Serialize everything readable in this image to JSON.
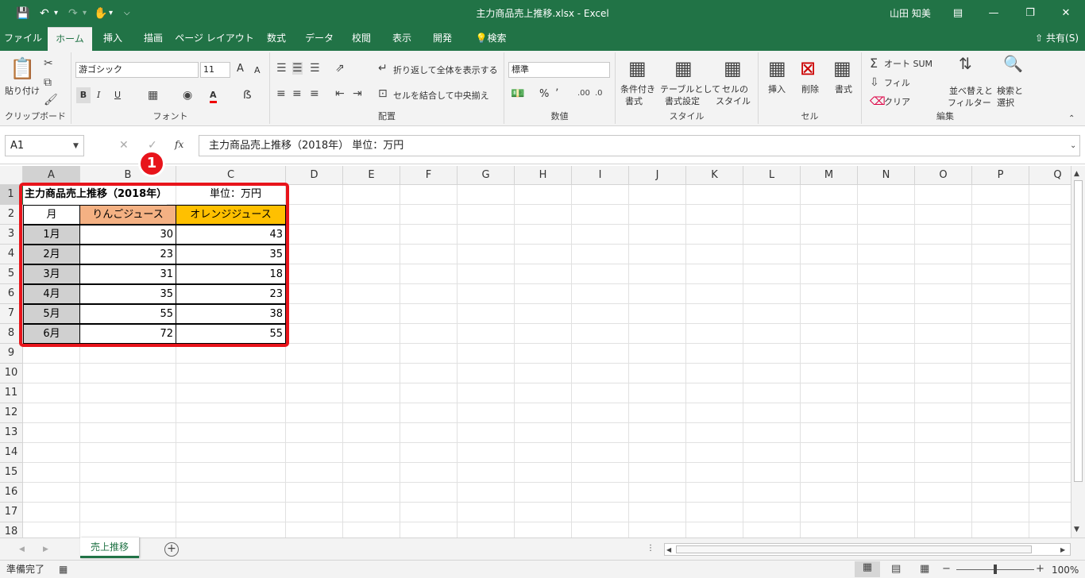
{
  "titlebar": {
    "title": "主力商品売上推移.xlsx  -  Excel",
    "user": "山田 知美",
    "save_icon": "save-icon",
    "undo_icon": "undo-icon",
    "redo_icon": "redo-icon",
    "touch_icon": "touch-mode-icon",
    "customize_icon": "customize-qat-icon"
  },
  "tabs": [
    "ファイル",
    "ホーム",
    "挿入",
    "描画",
    "ページ レイアウト",
    "数式",
    "データ",
    "校閲",
    "表示",
    "開発",
    "検索"
  ],
  "active_tab": "ホーム",
  "share_label": "共有(S)",
  "ribbon": {
    "clipboard": {
      "paste": "貼り付け",
      "label": "クリップボード"
    },
    "font": {
      "name": "游ゴシック",
      "size": "11",
      "bold": "B",
      "italic": "I",
      "underline": "U",
      "grow": "A",
      "shrink": "A",
      "font_color": "A",
      "label": "フォント"
    },
    "alignment": {
      "wrap": "折り返して全体を表示する",
      "merge": "セルを結合して中央揃え",
      "label": "配置"
    },
    "number": {
      "format": "標準",
      "percent": "%",
      "label": "数値"
    },
    "styles": {
      "conditional": "条件付き",
      "conditional2": "書式",
      "table": "テーブルとして",
      "table2": "書式設定",
      "cell": "セルの",
      "cell2": "スタイル",
      "label": "スタイル"
    },
    "cells": {
      "insert": "挿入",
      "delete": "削除",
      "format": "書式",
      "label": "セル"
    },
    "editing": {
      "autosum": "オート SUM",
      "fill": "フィル",
      "clear": "クリア",
      "sort": "並べ替えと",
      "sort2": "フィルター",
      "find": "検索と",
      "find2": "選択",
      "label": "編集"
    }
  },
  "formula_bar": {
    "namebox": "A1",
    "fx": "fx",
    "content": "主力商品売上推移（2018年）      単位：万円"
  },
  "columns": [
    "A",
    "B",
    "C",
    "D",
    "E",
    "F",
    "G",
    "H",
    "I",
    "J",
    "K",
    "L",
    "M",
    "N",
    "O",
    "P",
    "Q"
  ],
  "rows": [
    "1",
    "2",
    "3",
    "4",
    "5",
    "6",
    "7",
    "8",
    "9",
    "10",
    "11",
    "12",
    "13",
    "14",
    "15",
    "16",
    "17",
    "18"
  ],
  "sheet": {
    "title": "主力商品売上推移（2018年）",
    "unit": "単位：万円",
    "header": {
      "month": "月",
      "apple": "りんごジュース",
      "orange": "オレンジジュース"
    },
    "data": [
      {
        "month": "1月",
        "apple": "30",
        "orange": "43"
      },
      {
        "month": "2月",
        "apple": "23",
        "orange": "35"
      },
      {
        "month": "3月",
        "apple": "31",
        "orange": "18"
      },
      {
        "month": "4月",
        "apple": "35",
        "orange": "23"
      },
      {
        "month": "5月",
        "apple": "55",
        "orange": "38"
      },
      {
        "month": "6月",
        "apple": "72",
        "orange": "55"
      }
    ]
  },
  "annotation": {
    "marker": "1",
    "color": "#e8141b"
  },
  "sheet_tab": "売上推移",
  "status": {
    "ready": "準備完了",
    "zoom": "100%"
  },
  "colors": {
    "excel_green": "#217346",
    "apple_fill": "#f4b183",
    "orange_fill": "#ffc000",
    "month_fill": "#d0d0d0"
  }
}
